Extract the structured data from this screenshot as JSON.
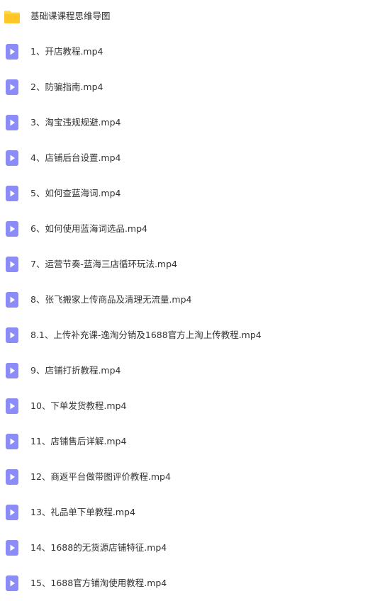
{
  "colors": {
    "folder_top": "#ffd84d",
    "folder_body": "#ffc627",
    "video_icon_bg": "#8b8cf7",
    "video_icon_play": "#ffffff",
    "text": "#333333"
  },
  "folder": {
    "icon": "folder-icon",
    "name": "基础课课程思维导图"
  },
  "files": [
    {
      "icon": "video-file-icon",
      "name": "1、开店教程.mp4"
    },
    {
      "icon": "video-file-icon",
      "name": "2、防骗指南.mp4"
    },
    {
      "icon": "video-file-icon",
      "name": "3、淘宝违规规避.mp4"
    },
    {
      "icon": "video-file-icon",
      "name": "4、店铺后台设置.mp4"
    },
    {
      "icon": "video-file-icon",
      "name": "5、如何查蓝海词.mp4"
    },
    {
      "icon": "video-file-icon",
      "name": "6、如何使用蓝海词选品.mp4"
    },
    {
      "icon": "video-file-icon",
      "name": "7、运营节奏-蓝海三店循环玩法.mp4"
    },
    {
      "icon": "video-file-icon",
      "name": "8、张飞搬家上传商品及清理无流量.mp4"
    },
    {
      "icon": "video-file-icon",
      "name": "8.1、上传补充课-逸淘分销及1688官方上淘上传教程.mp4"
    },
    {
      "icon": "video-file-icon",
      "name": "9、店铺打折教程.mp4"
    },
    {
      "icon": "video-file-icon",
      "name": "10、下单发货教程.mp4"
    },
    {
      "icon": "video-file-icon",
      "name": "11、店铺售后详解.mp4"
    },
    {
      "icon": "video-file-icon",
      "name": "12、商返平台做带图评价教程.mp4"
    },
    {
      "icon": "video-file-icon",
      "name": "13、礼品单下单教程.mp4"
    },
    {
      "icon": "video-file-icon",
      "name": "14、1688的无货源店铺特征.mp4"
    },
    {
      "icon": "video-file-icon",
      "name": "15、1688官方铺淘使用教程.mp4"
    }
  ]
}
